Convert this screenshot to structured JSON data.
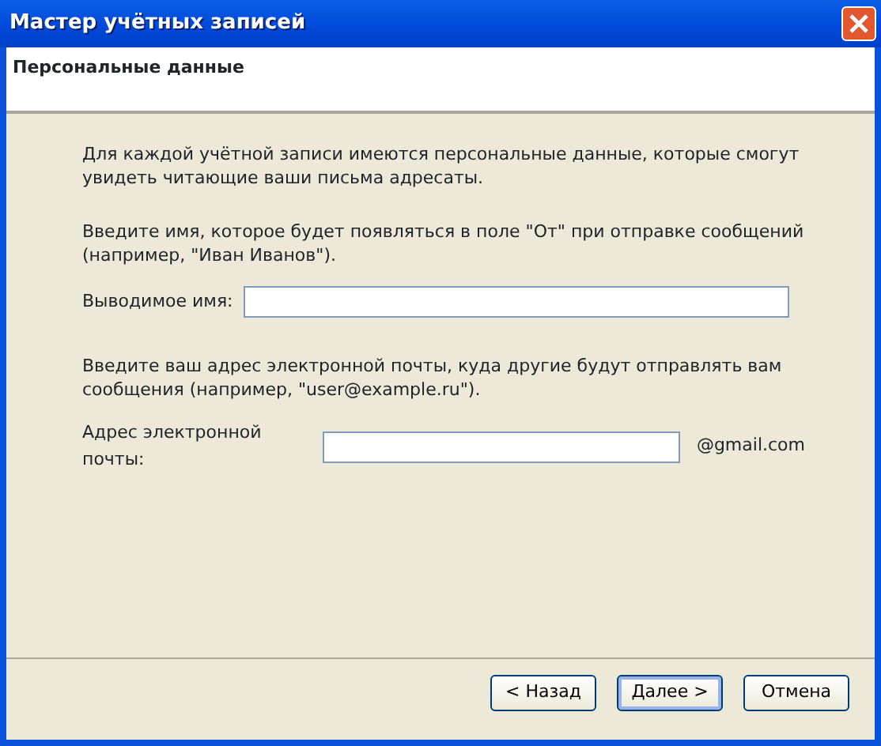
{
  "window": {
    "title": "Мастер учётных записей"
  },
  "header": {
    "title": "Персональные данные"
  },
  "intro": "Для каждой учётной записи имеются персональные данные, которые смогут увидеть читающие ваши письма адресаты.",
  "sections": [
    {
      "hint": "Введите имя, которое будет появляться в поле \"От\" при отправке сообщений (например, \"Иван Иванов\").",
      "label": "Выводимое имя:"
    },
    {
      "hint": "Введите ваш адрес электронной почты, куда другие будут отправлять вам сообщения (например, \"user@example.ru\").",
      "label": "Адрес электронной почты:",
      "suffix": "@gmail.com"
    }
  ],
  "buttons": [
    {
      "label": "< Назад",
      "default": false
    },
    {
      "label": "Далее >",
      "default": true
    },
    {
      "label": "Отмена",
      "default": false
    }
  ]
}
